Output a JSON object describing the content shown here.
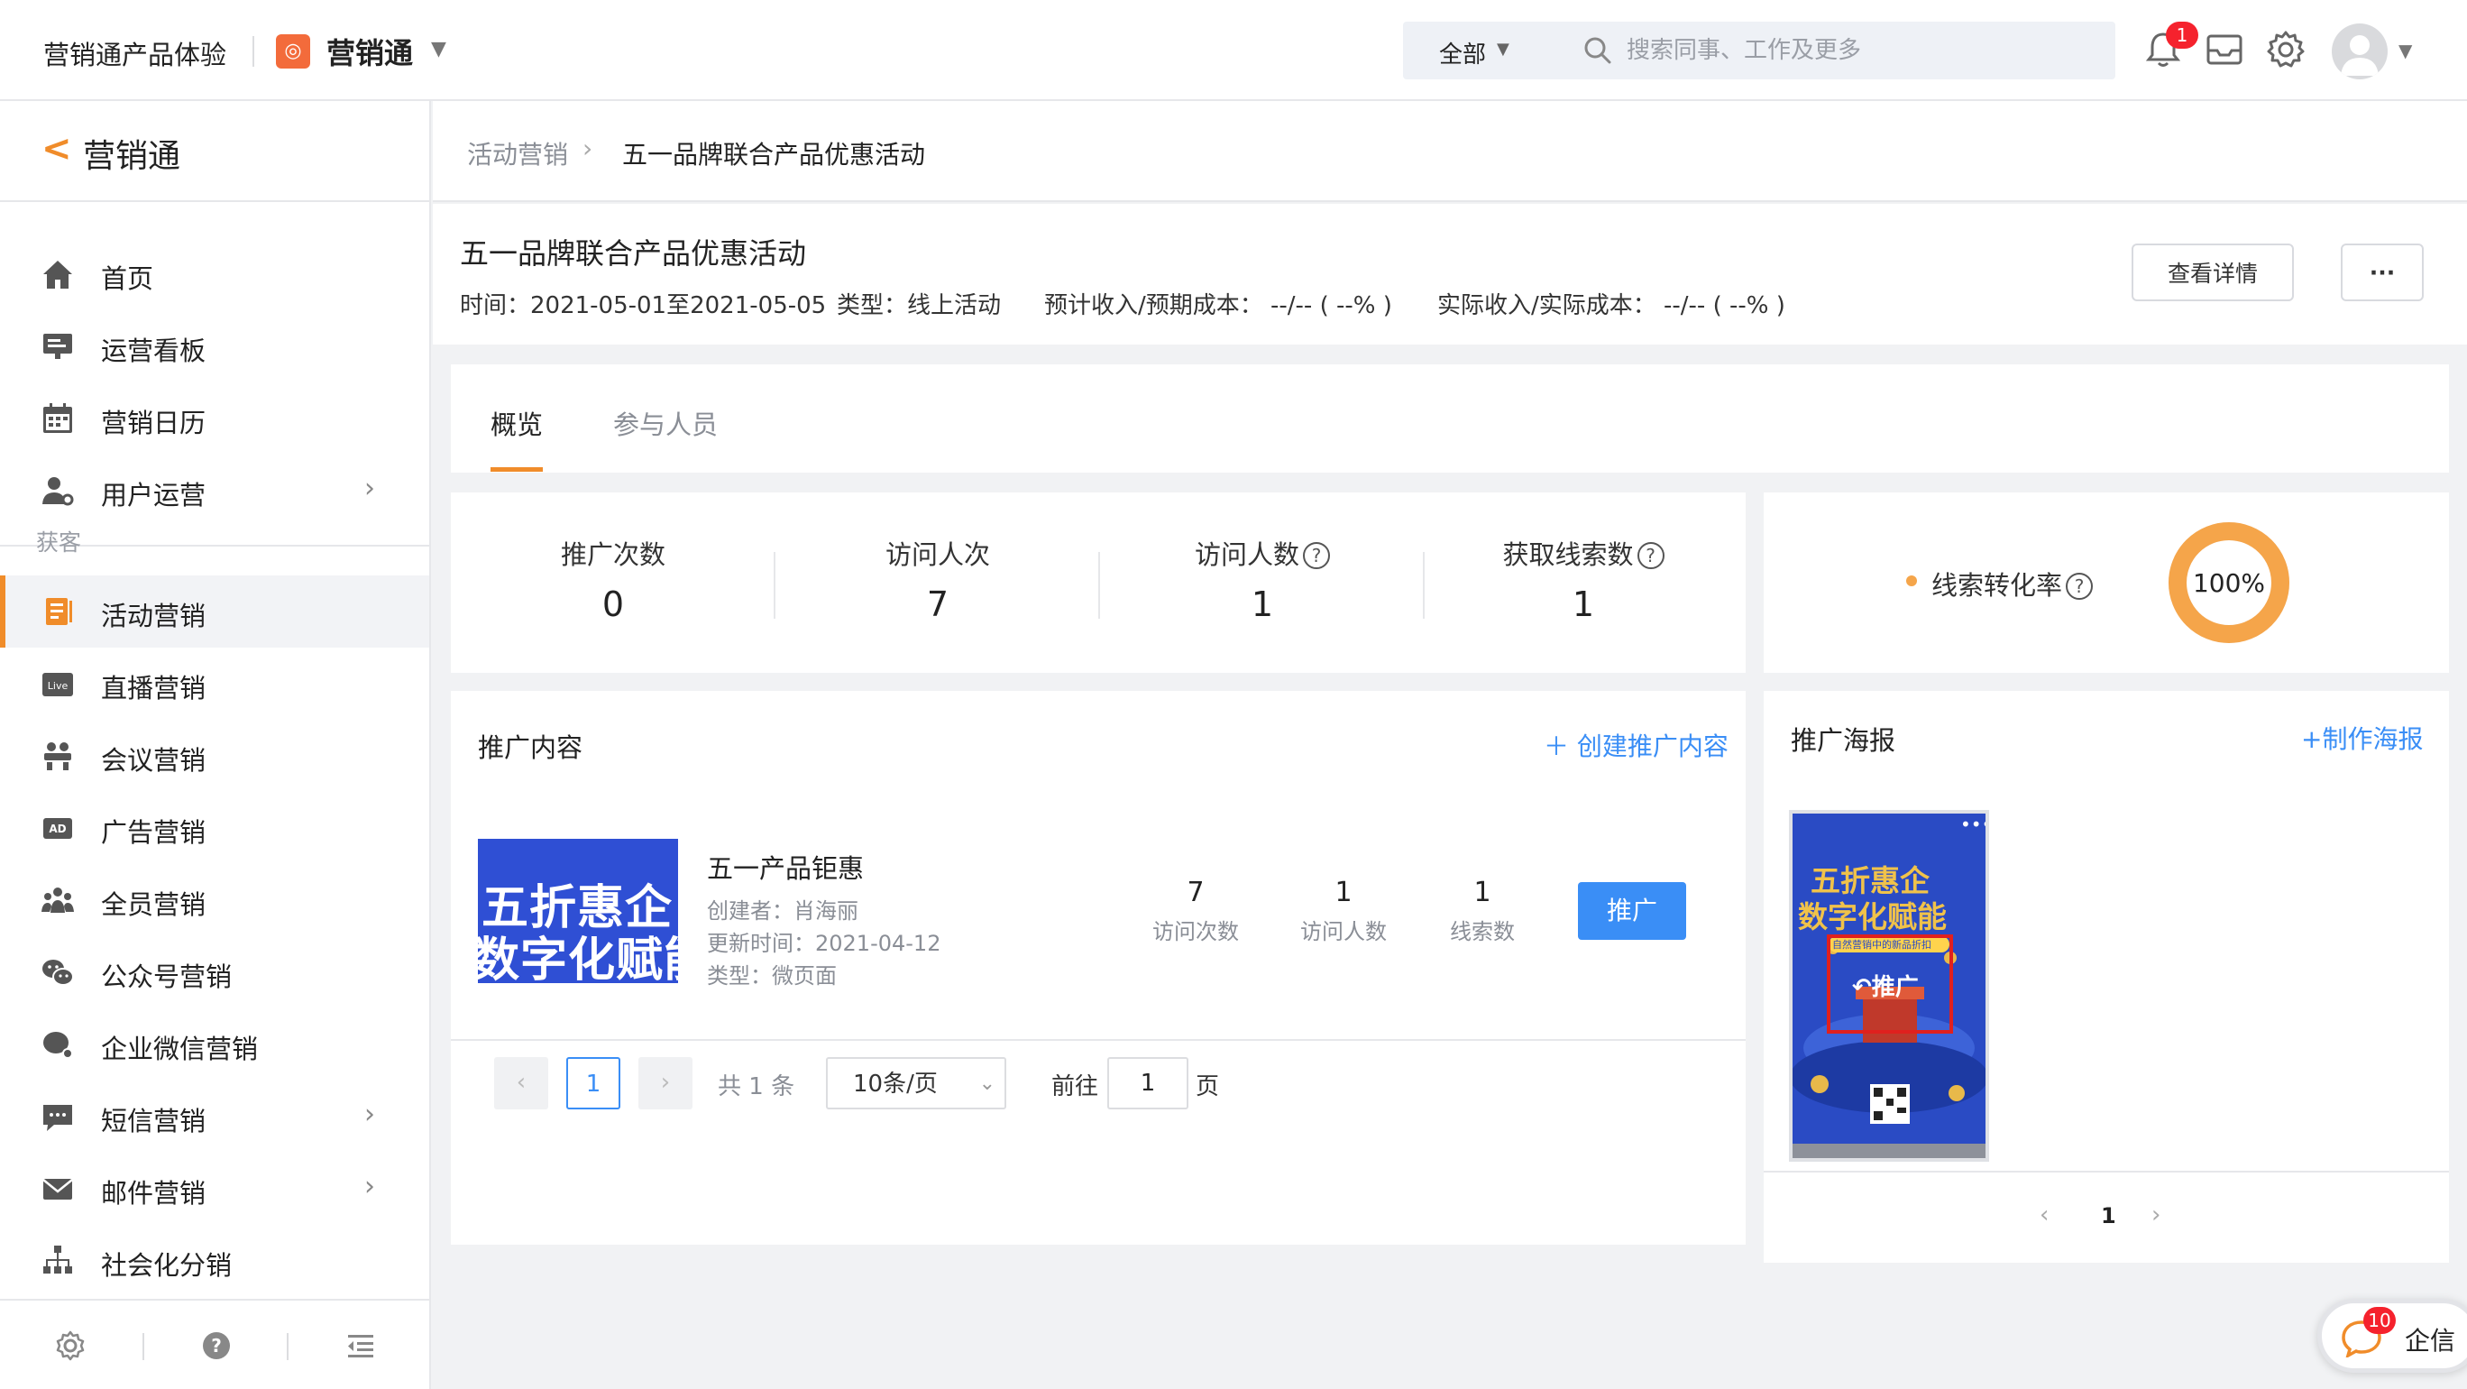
{
  "topbar": {
    "product_name": "营销通产品体验",
    "app_name": "营销通",
    "search_scope": "全部",
    "search_placeholder": "搜索同事、工作及更多",
    "notification_count": "1"
  },
  "sidebar": {
    "title": "营销通",
    "items_top": [
      {
        "label": "首页",
        "icon": "home-icon"
      },
      {
        "label": "运营看板",
        "icon": "dashboard-icon"
      },
      {
        "label": "营销日历",
        "icon": "calendar-icon"
      },
      {
        "label": "用户运营",
        "icon": "user-ops-icon",
        "has_arrow": true
      }
    ],
    "group_label": "获客",
    "items_bottom": [
      {
        "label": "活动营销",
        "icon": "activity-icon",
        "active": true
      },
      {
        "label": "直播营销",
        "icon": "live-icon"
      },
      {
        "label": "会议营销",
        "icon": "meeting-icon"
      },
      {
        "label": "广告营销",
        "icon": "ad-icon"
      },
      {
        "label": "全员营销",
        "icon": "team-icon"
      },
      {
        "label": "公众号营销",
        "icon": "wechat-icon"
      },
      {
        "label": "企业微信营销",
        "icon": "wework-icon"
      },
      {
        "label": "短信营销",
        "icon": "sms-icon",
        "has_arrow": true
      },
      {
        "label": "邮件营销",
        "icon": "mail-icon",
        "has_arrow": true
      },
      {
        "label": "社会化分销",
        "icon": "distribution-icon"
      }
    ]
  },
  "breadcrumb": {
    "parent": "活动营销",
    "current": "五一品牌联合产品优惠活动"
  },
  "activity": {
    "title": "五一品牌联合产品优惠活动",
    "time": "时间：2021-05-01至2021-05-05",
    "type": "类型：线上活动",
    "expected": "预计收入/预期成本： --/-- ( --% )",
    "actual": "实际收入/实际成本： --/-- ( --% )",
    "detail_button": "查看详情",
    "more_button": "···"
  },
  "tabs": [
    {
      "label": "概览",
      "active": true
    },
    {
      "label": "参与人员",
      "active": false
    }
  ],
  "stats": [
    {
      "label": "推广次数",
      "value": "0",
      "help": false
    },
    {
      "label": "访问人次",
      "value": "7",
      "help": false
    },
    {
      "label": "访问人数",
      "value": "1",
      "help": true
    },
    {
      "label": "获取线索数",
      "value": "1",
      "help": true
    }
  ],
  "conversion": {
    "label": "线索转化率",
    "value": "100%",
    "ring_fraction": 1.0,
    "color": "#f5a54a"
  },
  "promo_content": {
    "title": "推广内容",
    "create_link": "创建推广内容",
    "item": {
      "thumb_line1": "五折惠企",
      "thumb_line2": "数字化赋能",
      "name": "五一产品钜惠",
      "creator": "创建者：肖海丽",
      "updated": "更新时间：2021-04-12",
      "type": "类型：微页面",
      "metrics": [
        {
          "value": "7",
          "label": "访问次数"
        },
        {
          "value": "1",
          "label": "访问人数"
        },
        {
          "value": "1",
          "label": "线索数"
        }
      ],
      "promote_button": "推广"
    },
    "pager": {
      "page": "1",
      "total": "共 1 条",
      "page_size": "10条/页",
      "goto_label": "前往",
      "goto_value": "1",
      "goto_suffix": "页"
    }
  },
  "poster": {
    "title": "推广海报",
    "create_link": "+制作海报",
    "line1": "五折惠企",
    "line2": "数字化赋能",
    "tagline": "自然营销中的新品折扣",
    "overlay": "推广",
    "menu": "•••",
    "page": "1"
  },
  "chat": {
    "label": "企信",
    "count": "10"
  },
  "colors": {
    "accent": "#f08c2a",
    "link": "#3a8ef6",
    "badge": "#f5222d"
  }
}
